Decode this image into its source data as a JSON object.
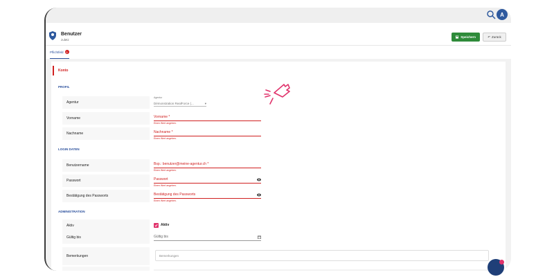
{
  "topbar": {
    "avatar_initial": "A"
  },
  "header": {
    "title": "Benutzer",
    "subtitle": "zuletz",
    "save_label": "Speichern",
    "back_label": "Zurück"
  },
  "tab": {
    "label": "Pflichtfeld",
    "badge": "5"
  },
  "section_konto": "Konto",
  "profil": {
    "title": "PROFIL",
    "agentur_label": "Agentur",
    "agentur_small": "Agentur",
    "agentur_value": "Démonstration RealForce (...",
    "vorname_label": "Vorname",
    "vorname_placeholder": "Vorname *",
    "vorname_hint": "Einen Wert angeben.",
    "nachname_label": "Nachname",
    "nachname_placeholder": "Nachname *",
    "nachname_hint": "Einen Wert angeben."
  },
  "login": {
    "title": "LOGIN DATEN",
    "user_label": "Benutzername",
    "user_placeholder": "Bsp.: benutzer@meine-agentur.ch *",
    "user_hint": "Einen Wert angeben.",
    "pw_label": "Passwort",
    "pw_placeholder": "Passwort",
    "pw_hint": "Einen Wert angeben.",
    "pw2_label": "Bestätigung des Passworts",
    "pw2_placeholder": "Bestätigung des Passworts",
    "pw2_hint": "Einen Wert angeben."
  },
  "admin": {
    "title": "ADMINISTRATION",
    "aktiv_label": "Aktiv",
    "aktiv_checkbox_label": "Aktiv",
    "gueltig_label": "Gültig bis",
    "gueltig_placeholder": "Gültig bis",
    "bem_label": "Bemerkungen",
    "bem_placeholder": "Bemerkungen"
  },
  "colors": {
    "accent": "#2a4f9c",
    "error": "#d01f1f",
    "save": "#2e8b3a",
    "pink": "#e0326b"
  },
  "icons": [
    "search-icon",
    "user-shield-icon",
    "save-icon",
    "back-arrow-icon",
    "chevron-down-icon",
    "eye-icon",
    "calendar-icon",
    "check-icon",
    "click-hand-icon",
    "chat-icon"
  ]
}
